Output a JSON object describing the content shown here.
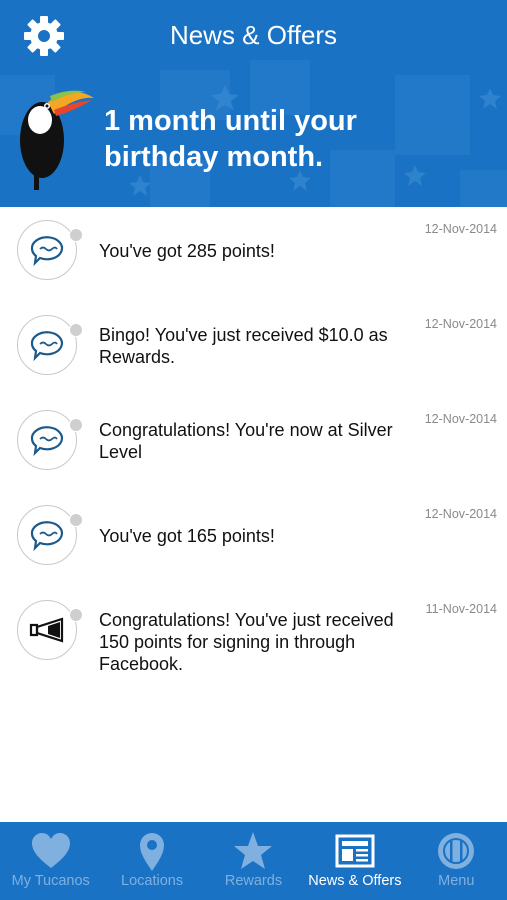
{
  "header": {
    "title": "News & Offers",
    "banner_text_line1": "1 month until your",
    "banner_text_line2": "birthday month.",
    "bg_color": "#1a72c4"
  },
  "notifications": [
    {
      "message": "You've got 285 points!",
      "date": "12-Nov-2014",
      "icon": "chat-bubble-icon"
    },
    {
      "message": "Bingo! You've just received $10.0 as Rewards.",
      "date": "12-Nov-2014",
      "icon": "chat-bubble-icon"
    },
    {
      "message": "Congratulations! You're now at Silver Level",
      "date": "12-Nov-2014",
      "icon": "chat-bubble-icon"
    },
    {
      "message": "You've got 165 points!",
      "date": "12-Nov-2014",
      "icon": "chat-bubble-icon"
    },
    {
      "message": "Congratulations! You've just received 150 points for signing in through Facebook.",
      "date": "11-Nov-2014",
      "icon": "megaphone-icon"
    }
  ],
  "tabs": [
    {
      "label": "My Tucanos",
      "icon": "heart-icon",
      "active": false
    },
    {
      "label": "Locations",
      "icon": "map-pin-icon",
      "active": false
    },
    {
      "label": "Rewards",
      "icon": "star-icon",
      "active": false
    },
    {
      "label": "News & Offers",
      "icon": "newspaper-icon",
      "active": true
    },
    {
      "label": "Menu",
      "icon": "plate-icon",
      "active": false
    }
  ]
}
